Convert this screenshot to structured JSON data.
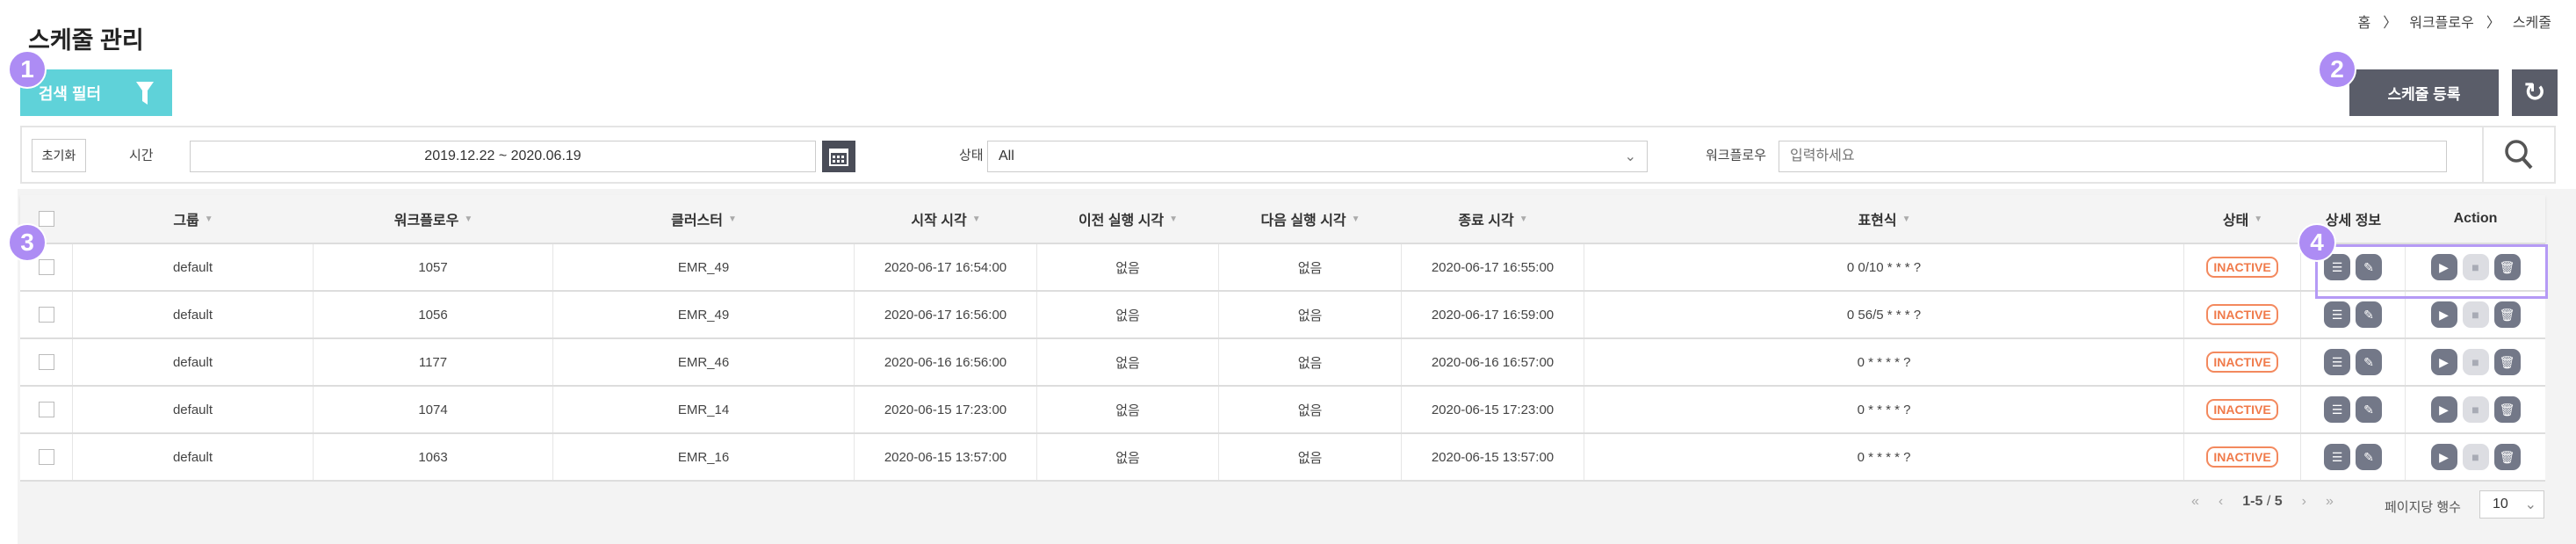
{
  "page": {
    "title": "스케줄 관리",
    "breadcrumb": [
      "홈",
      "워크플로우",
      "스케줄"
    ],
    "breadcrumb_sep": "〉"
  },
  "toolbar": {
    "filter_label": "검색 필터",
    "register_label": "스케줄 등록",
    "refresh_icon": "refresh-icon"
  },
  "badges": [
    "1",
    "2",
    "3",
    "4"
  ],
  "filter": {
    "reset_label": "초기화",
    "time_label": "시간",
    "time_value": "2019.12.22 ~ 2020.06.19",
    "status_label": "상태",
    "status_value": "All",
    "workflow_label": "워크플로우",
    "workflow_placeholder": "입력하세요"
  },
  "table": {
    "headers": [
      "그룹",
      "워크플로우",
      "클러스터",
      "시작 시각",
      "이전 실행 시각",
      "다음 실행 시각",
      "종료 시각",
      "표현식",
      "상태",
      "상세 정보",
      "Action"
    ],
    "rows": [
      [
        "default",
        "1057",
        "EMR_49",
        "2020-06-17 16:54:00",
        "없음",
        "없음",
        "2020-06-17 16:55:00",
        "0 0/10 * * * ?",
        "INACTIVE"
      ],
      [
        "default",
        "1056",
        "EMR_49",
        "2020-06-17 16:56:00",
        "없음",
        "없음",
        "2020-06-17 16:59:00",
        "0 56/5 * * * ?",
        "INACTIVE"
      ],
      [
        "default",
        "1177",
        "EMR_46",
        "2020-06-16 16:56:00",
        "없음",
        "없음",
        "2020-06-16 16:57:00",
        "0 * * * * ?",
        "INACTIVE"
      ],
      [
        "default",
        "1074",
        "EMR_14",
        "2020-06-15 17:23:00",
        "없음",
        "없음",
        "2020-06-15 17:23:00",
        "0 * * * * ?",
        "INACTIVE"
      ],
      [
        "default",
        "1063",
        "EMR_16",
        "2020-06-15 13:57:00",
        "없음",
        "없음",
        "2020-06-15 13:57:00",
        "0 * * * * ?",
        "INACTIVE"
      ]
    ]
  },
  "pagination": {
    "range": "1-5",
    "sep": "/",
    "total": "5",
    "rows_per_page_label": "페이지당 행수",
    "rows_per_page": "10"
  },
  "colors": {
    "filter_button": "#5fd2d9",
    "dark_button": "#5a5d69",
    "badge": "#ad8cf4",
    "inactive": "#f07a4a"
  }
}
